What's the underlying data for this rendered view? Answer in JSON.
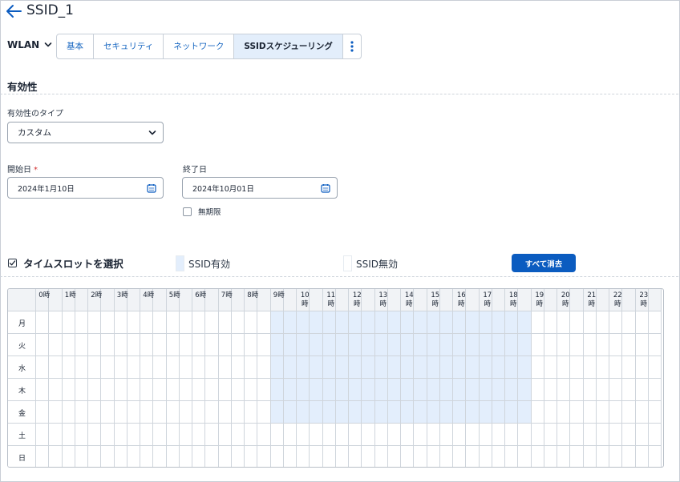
{
  "header": {
    "title": "SSID_1",
    "back_icon": "arrow-left-icon"
  },
  "wlan": {
    "label": "WLAN"
  },
  "tabs": [
    {
      "label": "基本",
      "active": false
    },
    {
      "label": "セキュリティ",
      "active": false
    },
    {
      "label": "ネットワーク",
      "active": false
    },
    {
      "label": "SSIDスケジューリング",
      "active": true
    }
  ],
  "validity": {
    "section_title": "有効性",
    "type_label": "有効性のタイプ",
    "type_value": "カスタム",
    "start_label": "開始日",
    "start_required": "*",
    "start_value": "2024年1月10日",
    "end_label": "終了日",
    "end_value": "2024年10月01日",
    "no_limit_label": "無期限",
    "no_limit_checked": false
  },
  "timeslot": {
    "select_label": "タイムスロットを選択",
    "select_checked": true,
    "legend_enabled": "SSID有効",
    "legend_disabled": "SSID無効",
    "clear_all_label": "すべて消去",
    "colors": {
      "enabled": "#e3eefc",
      "disabled": "#ffffff",
      "primary": "#0b5cc0"
    }
  },
  "schedule": {
    "hours": [
      "0時",
      "1時",
      "2時",
      "3時",
      "4時",
      "5時",
      "6時",
      "7時",
      "8時",
      "9時",
      "10\n時",
      "11\n時",
      "12\n時",
      "13\n時",
      "14\n時",
      "15\n時",
      "16\n時",
      "17\n時",
      "18\n時",
      "19\n時",
      "20\n時",
      "21\n時",
      "22\n時",
      "23\n時"
    ],
    "days": [
      "月",
      "火",
      "水",
      "木",
      "金",
      "土",
      "日"
    ],
    "slots_per_hour": 2,
    "enabled": [
      {
        "day": "月",
        "from_slot": 18,
        "to_slot": 37
      },
      {
        "day": "火",
        "from_slot": 18,
        "to_slot": 37
      },
      {
        "day": "水",
        "from_slot": 18,
        "to_slot": 37
      },
      {
        "day": "木",
        "from_slot": 18,
        "to_slot": 37
      },
      {
        "day": "金",
        "from_slot": 18,
        "to_slot": 37
      }
    ]
  }
}
